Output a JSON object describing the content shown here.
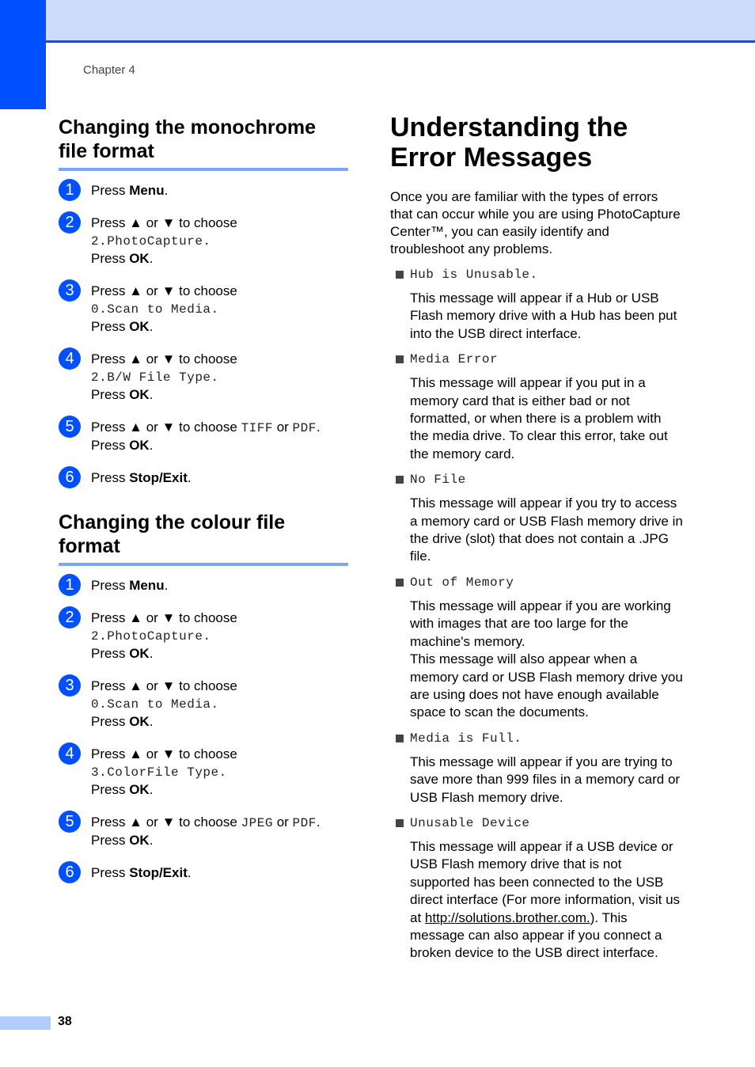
{
  "header": {
    "chapter": "Chapter 4"
  },
  "colors": {
    "accent": "#0050ff",
    "band": "#ccdcfa",
    "rule": "#7ea6f7",
    "footer_bar": "#b3ccfb"
  },
  "sections_left": [
    {
      "title": "Changing the monochrome file format",
      "steps": [
        {
          "num": "1",
          "pre": "Press ",
          "bold": "Menu",
          "post": "."
        },
        {
          "num": "2",
          "text": "Press ▲ or ▼ to choose",
          "mono": "2.PhotoCapture.",
          "ok_pre": "Press ",
          "ok": "OK",
          "ok_post": "."
        },
        {
          "num": "3",
          "text": "Press ▲ or ▼ to choose",
          "mono": "0.Scan to Media.",
          "ok_pre": "Press ",
          "ok": "OK",
          "ok_post": "."
        },
        {
          "num": "4",
          "text": "Press ▲ or ▼ to choose",
          "mono": "2.B/W File Type.",
          "ok_pre": "Press ",
          "ok": "OK",
          "ok_post": "."
        },
        {
          "num": "5",
          "text": "Press ▲ or ▼ to choose ",
          "opt1": "TIFF",
          "or": " or ",
          "opt2": "PDF",
          "dot": ".",
          "ok_pre": "Press ",
          "ok": "OK",
          "ok_post": "."
        },
        {
          "num": "6",
          "pre": "Press ",
          "bold": "Stop/Exit",
          "post": "."
        }
      ]
    },
    {
      "title": "Changing the colour file format",
      "steps": [
        {
          "num": "1",
          "pre": "Press ",
          "bold": "Menu",
          "post": "."
        },
        {
          "num": "2",
          "text": "Press ▲ or ▼ to choose",
          "mono": "2.PhotoCapture.",
          "ok_pre": "Press ",
          "ok": "OK",
          "ok_post": "."
        },
        {
          "num": "3",
          "text": "Press ▲ or ▼ to choose",
          "mono": "0.Scan to Media.",
          "ok_pre": "Press ",
          "ok": "OK",
          "ok_post": "."
        },
        {
          "num": "4",
          "text": "Press ▲ or ▼ to choose",
          "mono": "3.ColorFile Type.",
          "ok_pre": "Press ",
          "ok": "OK",
          "ok_post": "."
        },
        {
          "num": "5",
          "text": "Press ▲ or ▼ to choose ",
          "opt1": "JPEG",
          "or": " or ",
          "opt2": "PDF",
          "dot": ".",
          "ok_pre": "Press ",
          "ok": "OK",
          "ok_post": "."
        },
        {
          "num": "6",
          "pre": "Press ",
          "bold": "Stop/Exit",
          "post": "."
        }
      ]
    }
  ],
  "right": {
    "title_line1": "Understanding the",
    "title_line2": "Error Messages",
    "intro": "Once you are familiar with the types of errors that can occur while you are using PhotoCapture Center™, you can easily identify and troubleshoot any problems.",
    "errors": [
      {
        "title": "Hub is Unusable.",
        "desc": "This message will appear if a Hub or USB Flash memory drive with a Hub has been put into the USB direct interface."
      },
      {
        "title": "Media Error",
        "desc": "This message will appear if you put in a memory card that is either bad or not formatted, or when there is a problem with the media drive. To clear this error, take out the memory card."
      },
      {
        "title": "No File",
        "desc": "This message will appear if you try to access a memory card or USB Flash memory drive in the drive (slot) that does not contain a .JPG file."
      },
      {
        "title": "Out of Memory",
        "desc": "This message will appear if you are working with images that are too large for the machine's memory.",
        "desc2": "This message will also appear when a memory card or USB Flash memory drive you are using does not have enough available space to scan the documents."
      },
      {
        "title": "Media is Full.",
        "desc": "This message will appear if you are trying to save more than 999 files in a memory card or USB Flash memory drive."
      },
      {
        "title": "Unusable Device",
        "desc_pre": "This message will appear if a USB device or USB Flash memory drive that is not supported has been connected to the USB direct interface (For more information, visit us at ",
        "link": "http://solutions.brother.com.",
        "desc_post": "). This message can also appear if you connect a broken device to the USB direct interface."
      }
    ]
  },
  "footer": {
    "page_number": "38"
  }
}
